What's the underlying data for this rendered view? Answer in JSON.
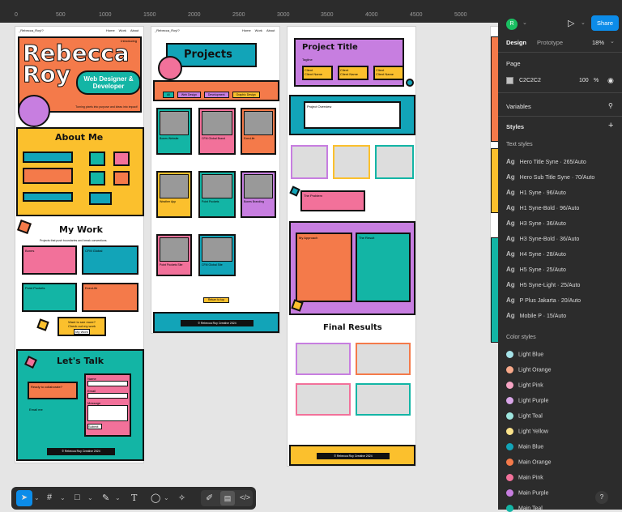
{
  "ruler": {
    "ticks": [
      "0",
      "500",
      "1000",
      "1500",
      "2000",
      "2500",
      "3000",
      "3500",
      "4000",
      "4500",
      "5000"
    ]
  },
  "canvas": {
    "frame1": {
      "nav_logo": "_Rebecca_Roy!?",
      "nav_links": [
        "Home",
        "Work",
        "About"
      ],
      "introducing": "Introducing",
      "hero_title_1": "Rebecca",
      "hero_title_2": "Roy",
      "hero_badge": "Web Designer & Developer",
      "hero_tagline": "Turning pixels into purpose and ideas into impact!",
      "about_title": "About Me",
      "work_title": "My Work",
      "work_subtitle": "Projects that push boundaries and break conventions.",
      "work_cards": [
        "Bones",
        "CFM Global",
        "Point Pockets",
        "ExecLife"
      ],
      "learn_more": "Learn More",
      "cta_title": "Want to see more?",
      "cta_sub": "Check out my work",
      "cta_button": "My Work",
      "talk_title": "Let's Talk",
      "talk_left": "Ready to collaborate?",
      "talk_email": "Email me",
      "form_labels": [
        "Name",
        "Email",
        "Message"
      ],
      "submit": "Submit",
      "footer": "© Rebecca Roy Creative 2024"
    },
    "frame2": {
      "nav_logo": "_Rebecca_Roy!?",
      "nav_links": [
        "Home",
        "Work",
        "About"
      ],
      "title": "Projects",
      "filters": [
        "All",
        "Web Design",
        "Development",
        "Graphic Design"
      ],
      "cards": [
        "Bones Website",
        "CFM Global Brand",
        "ExecLife",
        "Weather App",
        "Point Pockets",
        "Bones Branding",
        "Point Pockets Site",
        "CFM Global Site"
      ],
      "return_button": "Return to top",
      "footer": "© Rebecca Roy Creative 2024"
    },
    "frame3": {
      "title": "Project Title",
      "tagline": "Tagline",
      "clients": [
        "Client",
        "Client",
        "Client"
      ],
      "client_name": "Client Name",
      "overview": "Project Overview",
      "problem": "The Problem",
      "approach": "My Approach",
      "result": "The Result",
      "final": "Final Results",
      "footer": "© Rebecca Roy Creative 2024"
    }
  },
  "panel": {
    "avatar": "R",
    "share": "Share",
    "zoom": "18%",
    "tabs": [
      "Design",
      "Prototype"
    ],
    "page_label": "Page",
    "page_color": "C2C2C2",
    "page_opacity": "100",
    "page_pct": "%",
    "variables": "Variables",
    "styles": "Styles",
    "text_styles_label": "Text styles",
    "text_styles": [
      "Hero Title Syne · 265/Auto",
      "Hero Sub Title Syne · 70/Auto",
      "H1 Syne · 96/Auto",
      "H1 Syne-Bold · 96/Auto",
      "H3 Syne · 36/Auto",
      "H3 Syne-Bold · 36/Auto",
      "H4 Syne · 28/Auto",
      "H5 Syne · 25/Auto",
      "H5 Syne-Light · 25/Auto",
      "P Plus Jakarta · 20/Auto",
      "Mobile P · 15/Auto"
    ],
    "ag": "Ag",
    "color_styles_label": "Color styles",
    "color_styles": [
      {
        "name": "Light Blue",
        "color": "#a6e3e9"
      },
      {
        "name": "Light Orange",
        "color": "#f8a98a"
      },
      {
        "name": "Light Pink",
        "color": "#f6a4c4"
      },
      {
        "name": "Light Purple",
        "color": "#d9a6e8"
      },
      {
        "name": "Light Teal",
        "color": "#9ee6df"
      },
      {
        "name": "Light Yellow",
        "color": "#fbe38b"
      },
      {
        "name": "Main Blue",
        "color": "#12a4b8"
      },
      {
        "name": "Main Orange",
        "color": "#f47a4a"
      },
      {
        "name": "Main Pink",
        "color": "#f2719a"
      },
      {
        "name": "Main Purple",
        "color": "#c77ee0"
      },
      {
        "name": "Main Teal",
        "color": "#13b5a5"
      }
    ],
    "help": "?"
  },
  "toolbar": {
    "tools": [
      "move-tool",
      "frame-tool",
      "shape-tool",
      "pen-tool",
      "text-tool",
      "comment-tool",
      "actions-tool",
      "draw-mode",
      "dev-mode",
      "code-mode"
    ]
  },
  "colors": {
    "orange": "#f47a4a",
    "yellow": "#fbc02d",
    "teal": "#13b5a5",
    "blue": "#12a4b8",
    "purple": "#c77ee0",
    "pink": "#f2719a"
  }
}
